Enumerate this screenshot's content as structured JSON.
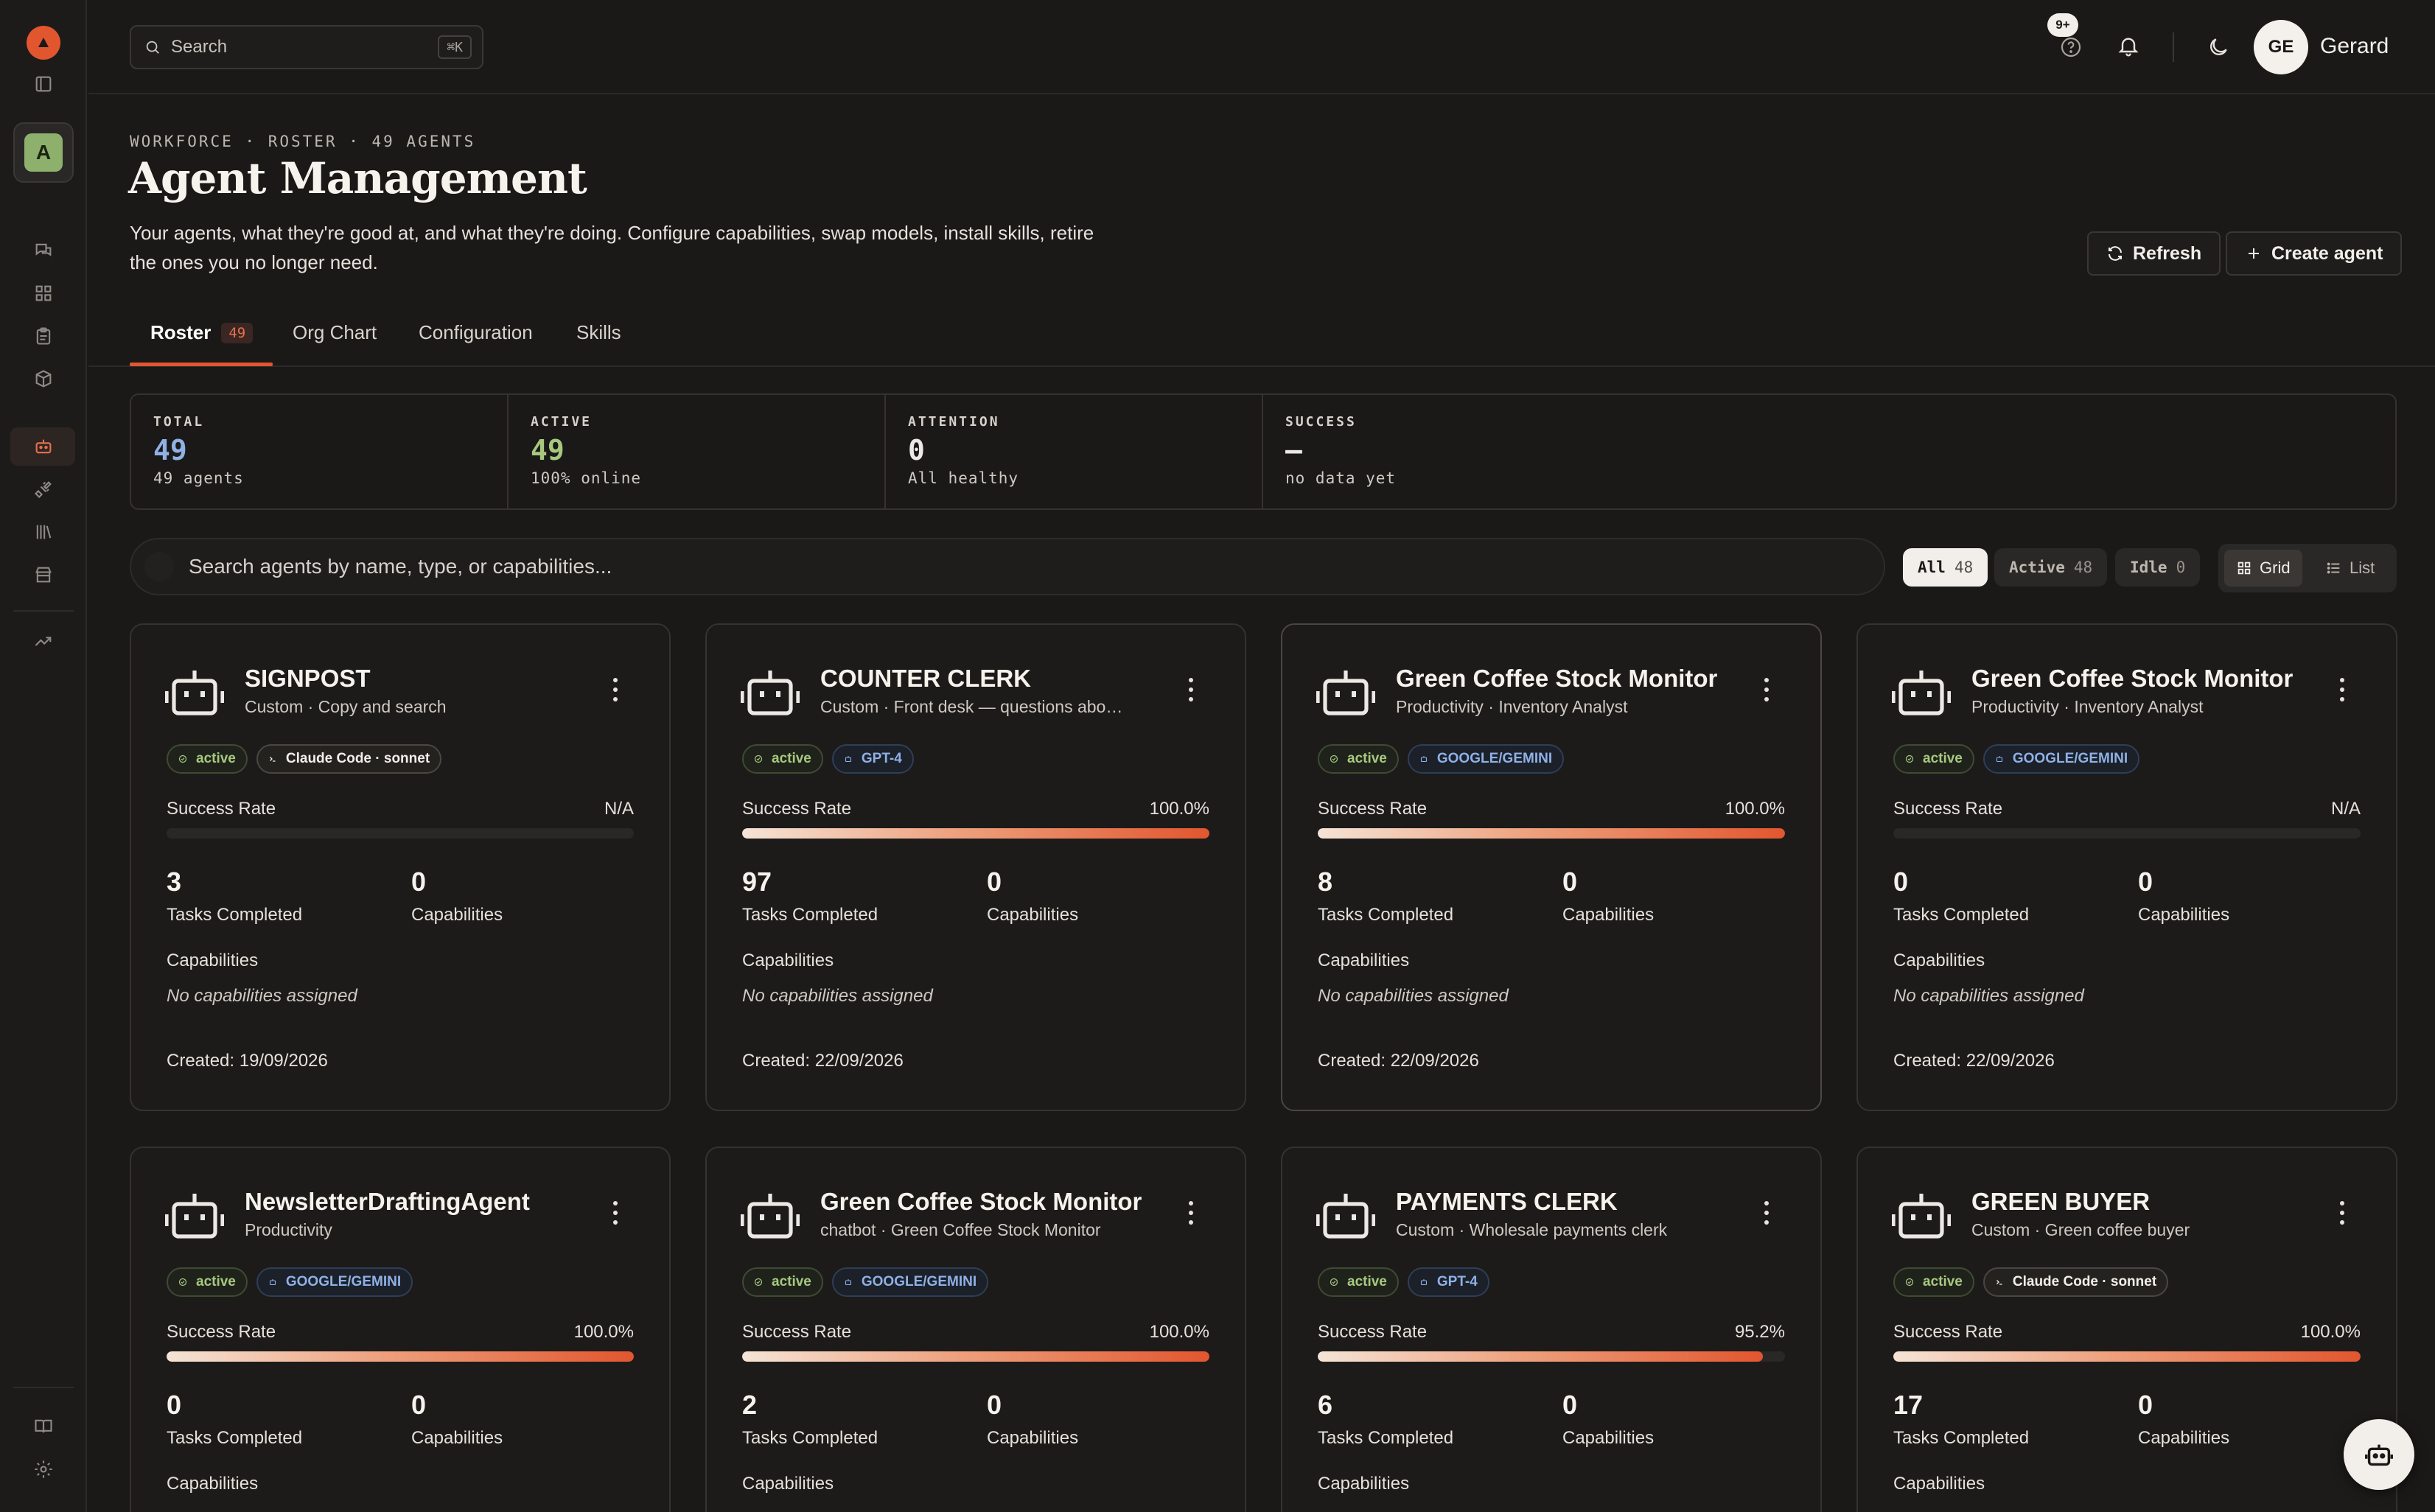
{
  "topbar": {
    "search_label": "Search",
    "search_shortcut": "⌘K",
    "notification_count": "9+",
    "user_initials": "GE",
    "user_name": "Gerard"
  },
  "sidebar": {
    "workspace_initial": "A",
    "items": [
      {
        "icon": "chat-icon"
      },
      {
        "icon": "grid-icon"
      },
      {
        "icon": "clipboard-icon"
      },
      {
        "icon": "cube-icon"
      },
      {
        "icon": "robot-icon"
      },
      {
        "icon": "plug-icon"
      },
      {
        "icon": "library-icon"
      },
      {
        "icon": "store-icon"
      },
      {
        "icon": "trending-icon"
      }
    ]
  },
  "header": {
    "breadcrumb": "WORKFORCE · ROSTER · 49 AGENTS",
    "title": "Agent Management",
    "description": "Your agents, what they're good at, and what they're doing. Configure capabilities, swap models, install skills, retire the ones you no longer need.",
    "refresh_label": "Refresh",
    "create_label": "Create agent"
  },
  "tabs": [
    {
      "label": "Roster",
      "count": "49",
      "active": true
    },
    {
      "label": "Org Chart"
    },
    {
      "label": "Configuration"
    },
    {
      "label": "Skills"
    }
  ],
  "stats": [
    {
      "label": "TOTAL",
      "value": "49",
      "sub": "49 agents",
      "color": "#8fb1e6"
    },
    {
      "label": "ACTIVE",
      "value": "49",
      "sub": "100% online",
      "color": "#a7c97f"
    },
    {
      "label": "ATTENTION",
      "value": "0",
      "sub": "All healthy",
      "color": "#f2efea"
    },
    {
      "label": "SUCCESS",
      "value": "—",
      "sub": "no data yet",
      "color": "#f2efea"
    }
  ],
  "filters": {
    "search_placeholder": "Search agents by name, type, or capabilities...",
    "all_label": "All",
    "all_count": "48",
    "active_label": "Active",
    "active_count": "48",
    "idle_label": "Idle",
    "idle_count": "0",
    "grid_label": "Grid",
    "list_label": "List"
  },
  "card_labels": {
    "success_rate": "Success Rate",
    "tasks_completed": "Tasks Completed",
    "capabilities": "Capabilities",
    "no_capabilities": "No capabilities assigned"
  },
  "agents": [
    {
      "name": "SIGNPOST",
      "subtitle": "Custom · Copy and search",
      "status": "active",
      "model": "Claude Code · sonnet",
      "model_kind": "claude",
      "success_rate": "N/A",
      "success_pct": 0,
      "tasks": "3",
      "capabilities": "0",
      "created": "Created: 19/09/2026"
    },
    {
      "name": "COUNTER CLERK",
      "subtitle": "Custom · Front desk — questions about...",
      "status": "active",
      "model": "GPT-4",
      "model_kind": "model",
      "success_rate": "100.0%",
      "success_pct": 100,
      "tasks": "97",
      "capabilities": "0",
      "created": "Created: 22/09/2026"
    },
    {
      "name": "Green Coffee Stock Monitor",
      "subtitle": "Productivity · Inventory Analyst",
      "status": "active",
      "model": "GOOGLE/GEMINI",
      "model_kind": "model",
      "success_rate": "100.0%",
      "success_pct": 100,
      "tasks": "8",
      "capabilities": "0",
      "created": "Created: 22/09/2026"
    },
    {
      "name": "Green Coffee Stock Monitor",
      "subtitle": "Productivity · Inventory Analyst",
      "status": "active",
      "model": "GOOGLE/GEMINI",
      "model_kind": "model",
      "success_rate": "N/A",
      "success_pct": 0,
      "tasks": "0",
      "capabilities": "0",
      "created": "Created: 22/09/2026"
    },
    {
      "name": "NewsletterDraftingAgent",
      "subtitle": "Productivity",
      "status": "active",
      "model": "GOOGLE/GEMINI",
      "model_kind": "model",
      "success_rate": "100.0%",
      "success_pct": 100,
      "tasks": "0",
      "capabilities": "0"
    },
    {
      "name": "Green Coffee Stock Monitor",
      "subtitle": "chatbot · Green Coffee Stock Monitor",
      "status": "active",
      "model": "GOOGLE/GEMINI",
      "model_kind": "model",
      "success_rate": "100.0%",
      "success_pct": 100,
      "tasks": "2",
      "capabilities": "0"
    },
    {
      "name": "PAYMENTS CLERK",
      "subtitle": "Custom · Wholesale payments clerk",
      "status": "active",
      "model": "GPT-4",
      "model_kind": "model",
      "success_rate": "95.2%",
      "success_pct": 95.2,
      "tasks": "6",
      "capabilities": "0"
    },
    {
      "name": "GREEN BUYER",
      "subtitle": "Custom · Green coffee buyer",
      "status": "active",
      "model": "Claude Code · sonnet",
      "model_kind": "claude",
      "success_rate": "100.0%",
      "success_pct": 100,
      "tasks": "17",
      "capabilities": "0"
    }
  ]
}
